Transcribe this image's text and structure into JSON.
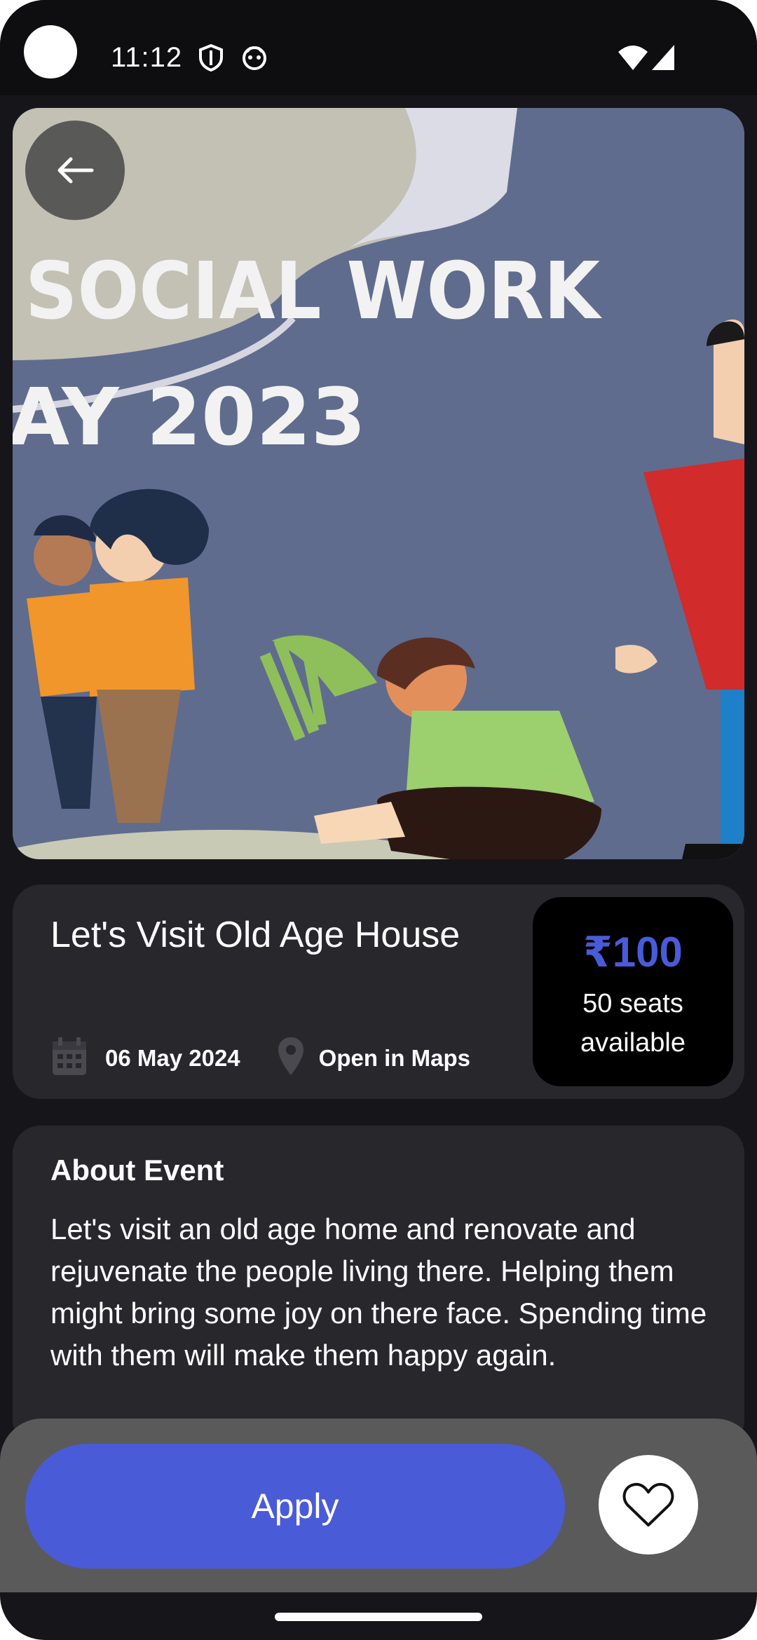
{
  "status_bar": {
    "time": "11:12",
    "icons": [
      "shield-icon",
      "face-icon",
      "wifi-icon",
      "signal-icon"
    ]
  },
  "hero": {
    "banner_line_1": "SOCIAL WORK",
    "banner_line_2": "AY 2023",
    "carousel_dot_count": 5,
    "back_icon": "arrow-left-icon"
  },
  "event": {
    "title": "Let's Visit Old Age House",
    "date": "06 May 2024",
    "location_label": "Open in Maps",
    "price": "₹100",
    "seats": "50 seats available"
  },
  "about": {
    "heading": "About Event",
    "body": "Let's visit an old age home and renovate and rejuvenate the people living there. Helping them might bring some joy on there face. Spending time with them will make them happy again."
  },
  "actions": {
    "apply_label": "Apply",
    "favorite_icon": "heart-icon"
  },
  "colors": {
    "accent": "#4a5bd8",
    "background": "#16151a",
    "card": "#28272c",
    "action_bar": "#5a5a5a"
  }
}
